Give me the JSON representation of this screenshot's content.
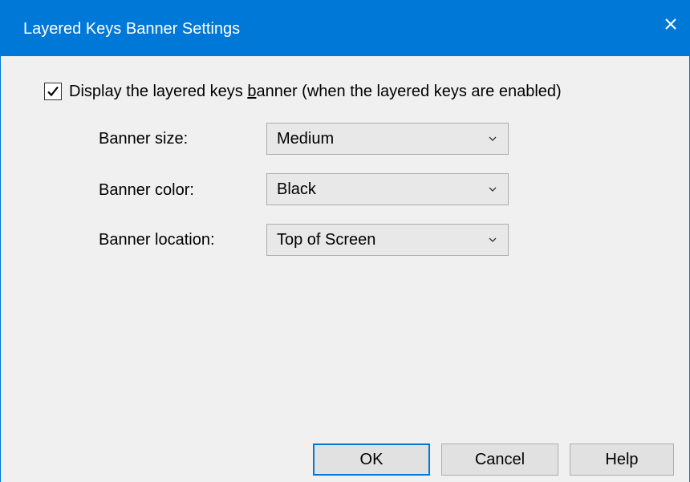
{
  "window": {
    "title": "Layered Keys Banner Settings",
    "close_icon": "close-icon",
    "accent_color": "#0078d7"
  },
  "options": {
    "display_banner": {
      "checked": true,
      "label_before": "Display the layered keys ",
      "label_mnemonic": "b",
      "label_after": "anner (when the layered keys are enabled)"
    },
    "banner_size": {
      "label": "Banner size:",
      "value": "Medium"
    },
    "banner_color": {
      "label": "Banner color:",
      "value": "Black"
    },
    "banner_location": {
      "label": "Banner location:",
      "value": "Top of Screen"
    }
  },
  "buttons": {
    "ok": "OK",
    "cancel": "Cancel",
    "help": "Help"
  }
}
